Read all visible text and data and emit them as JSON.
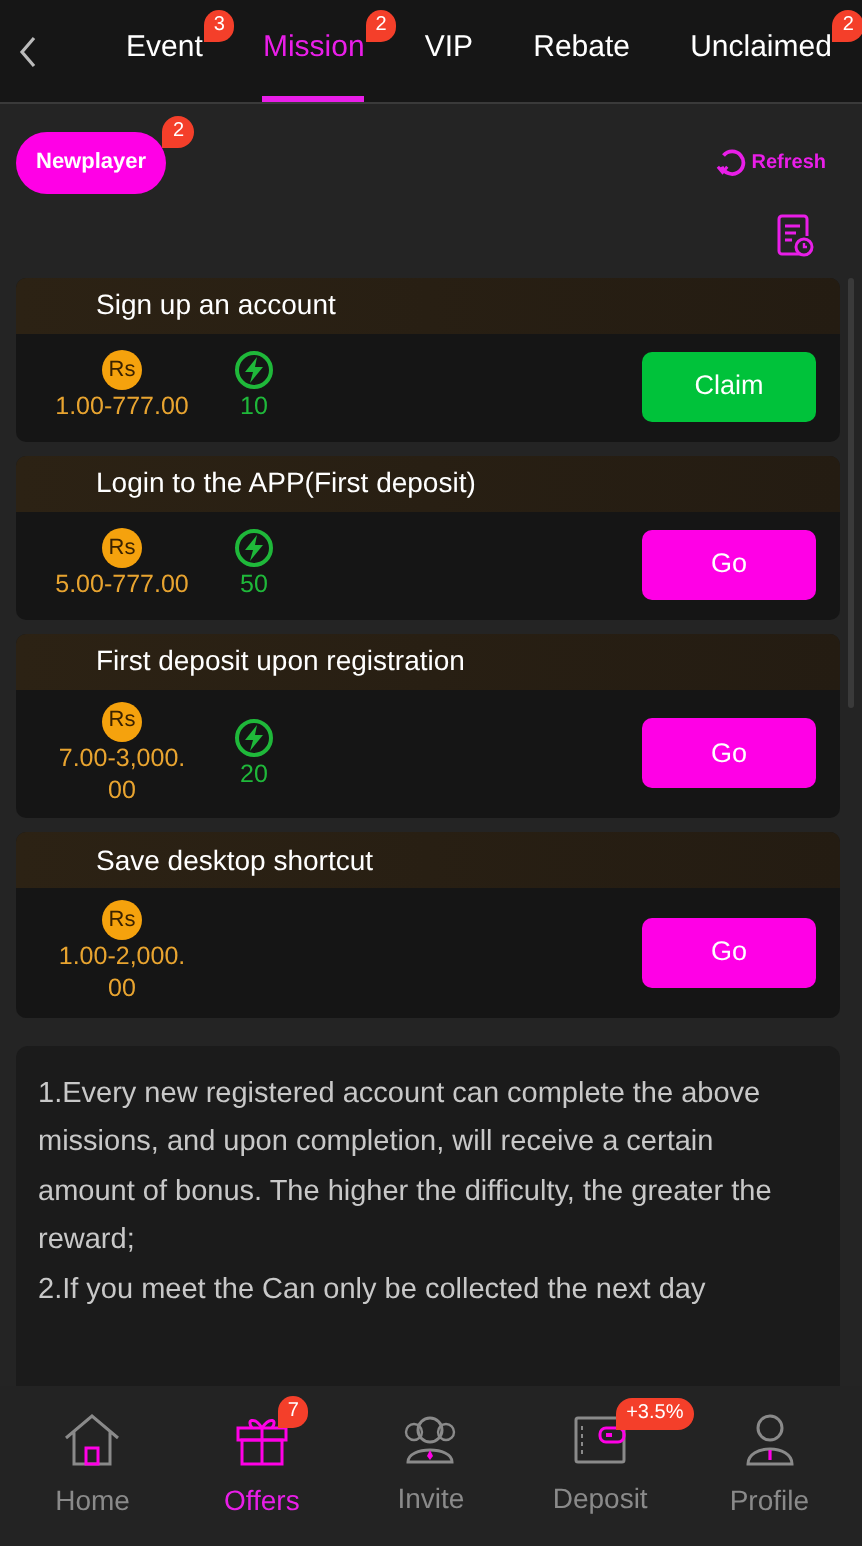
{
  "tabs": [
    {
      "label": "Event",
      "badge": "3",
      "selected": false
    },
    {
      "label": "Mission",
      "badge": "2",
      "selected": true
    },
    {
      "label": "VIP",
      "selected": false
    },
    {
      "label": "Rebate",
      "selected": false
    },
    {
      "label": "Unclaimed",
      "badge": "2",
      "selected": false
    }
  ],
  "filter": {
    "label": "Newplayer",
    "badge": "2"
  },
  "refresh": "Refresh",
  "missions": [
    {
      "title": "Sign up an account",
      "coin": "Rs",
      "amount": "1.00-777.00",
      "energy": "10",
      "action": {
        "label": "Claim",
        "kind": "claim"
      }
    },
    {
      "title": "Login to the APP(First deposit)",
      "coin": "Rs",
      "amount": "5.00-777.00",
      "energy": "50",
      "action": {
        "label": "Go",
        "kind": "go"
      }
    },
    {
      "title": "First deposit upon registration",
      "coin": "Rs",
      "amount": "7.00-3,000.00",
      "energy": "20",
      "action": {
        "label": "Go",
        "kind": "go"
      }
    },
    {
      "title": "Save desktop shortcut",
      "coin": "Rs",
      "amount": "1.00-2,000.00",
      "action": {
        "label": "Go",
        "kind": "go"
      }
    }
  ],
  "rules": [
    "1.Every new registered account can complete the above missions, and upon completion, will receive a certain amount of bonus. The higher the difficulty, the greater the reward;",
    "2.If you meet the Can only be collected the next day"
  ],
  "bottom_nav": [
    {
      "label": "Home",
      "kind": "home",
      "selected": false
    },
    {
      "label": "Offers",
      "kind": "gift",
      "badge": "7",
      "selected": true
    },
    {
      "label": "Invite",
      "kind": "people",
      "selected": false
    },
    {
      "label": "Deposit",
      "kind": "wallet",
      "badge": "+3.5%",
      "selected": false
    },
    {
      "label": "Profile",
      "kind": "person",
      "selected": false
    }
  ]
}
